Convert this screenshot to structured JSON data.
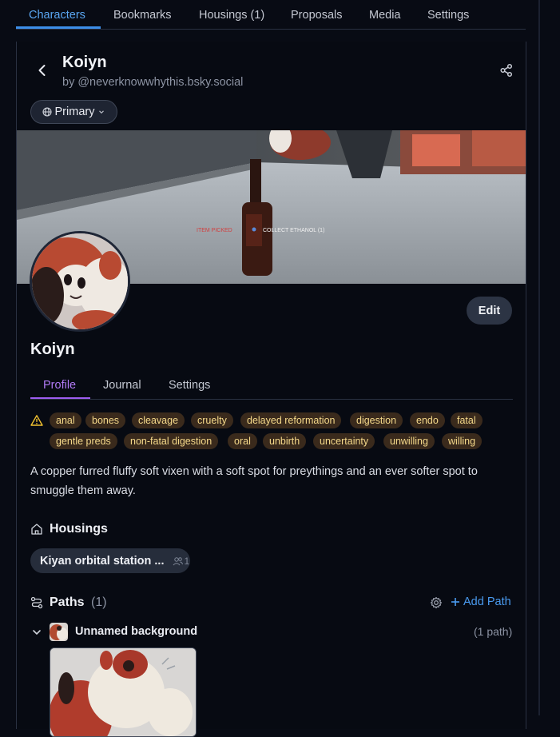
{
  "top_tabs": [
    {
      "label": "Characters"
    },
    {
      "label": "Bookmarks"
    },
    {
      "label": "Housings (1)"
    },
    {
      "label": "Proposals"
    },
    {
      "label": "Media"
    },
    {
      "label": "Settings"
    }
  ],
  "header": {
    "title": "Koiyn",
    "byline": "by @neverknowwhythis.bsky.social",
    "version_label": "Primary"
  },
  "banner": {
    "hud_left": "ITEM PICKED",
    "hud_right": "COLLECT ETHANOL   (1)"
  },
  "profile": {
    "name": "Koiyn",
    "edit_label": "Edit",
    "sub_tabs": [
      {
        "label": "Profile"
      },
      {
        "label": "Journal"
      },
      {
        "label": "Settings"
      }
    ],
    "tags": [
      "anal",
      "bones",
      "cleavage",
      "cruelty",
      "delayed reformation",
      "digestion",
      "endo",
      "fatal",
      "gentle preds",
      "non-fatal digestion",
      "oral",
      "unbirth",
      "uncertainty",
      "unwilling",
      "willing"
    ],
    "description": "A copper furred fluffy soft vixen with a soft spot for preythings and an ever softer spot to smuggle them away."
  },
  "housings": {
    "title": "Housings",
    "items": [
      {
        "name": "Kiyan orbital station ...",
        "members": "1"
      }
    ]
  },
  "paths": {
    "title": "Paths",
    "count": "(1)",
    "add_label": "Add Path",
    "background_name": "Unnamed background",
    "background_count": "(1 path)"
  },
  "colors": {
    "accent_blue": "#3d8ee8",
    "accent_purple": "#9d5df0",
    "tag_bg": "#3a2a1c",
    "tag_text": "#f5d98a",
    "warning": "#f2c230"
  }
}
